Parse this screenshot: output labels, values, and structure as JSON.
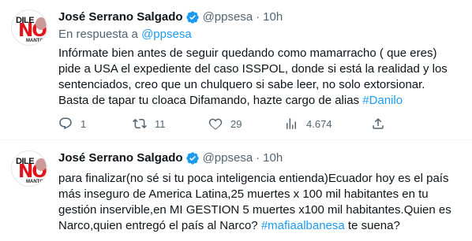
{
  "tweets": [
    {
      "author_name": "José Serrano Salgado",
      "handle": "@ppsesa",
      "separator": "·",
      "time": "10h",
      "reply_prefix": "En respuesta a ",
      "reply_handle": "@ppsesa",
      "text_parts": [
        "Infórmate bien antes de seguir quedando como mamarracho ( que eres) pide a USA el expediente del caso ISSPOL, donde si está la realidad y los sentenciados, creo que un chulquero si sabe leer, no solo extorsionar. Basta de tapar tu cloaca     Difamando, hazte cargo de alias ",
        "#Danilo"
      ],
      "counts": {
        "replies": "1",
        "retweets": "11",
        "likes": "29",
        "views": "4.674"
      }
    },
    {
      "author_name": "José Serrano Salgado",
      "handle": "@ppsesa",
      "separator": "·",
      "time": "10h",
      "text_parts": [
        "para finalizar(no sé si tu poca inteligencia entienda)Ecuador hoy es el país más inseguro de America Latina,25 muertes x 100 mil habitantes en tu gestión inservible,en MI GESTION 5 muertes x100 mil habitantes.Quien es Narco,quien entregó el país al Narco? ",
        "#mafiaalbanesa",
        " te suena?"
      ]
    }
  ],
  "avatar": {
    "top_text": "DILE",
    "main_text": "NO",
    "bottom_text": "MANTOS"
  },
  "colors": {
    "accent": "#1d9bf0",
    "muted": "#536471",
    "text": "#0f1419",
    "avatar_red": "#e0141a"
  },
  "icons": [
    "verified-badge-icon",
    "reply-icon",
    "retweet-icon",
    "like-icon",
    "views-icon",
    "share-icon"
  ]
}
